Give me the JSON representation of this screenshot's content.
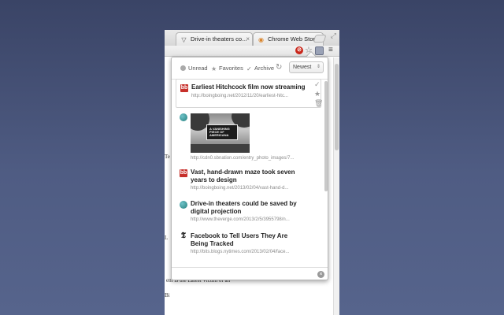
{
  "browser": {
    "tabs": [
      {
        "label": "Drive-in theaters co...",
        "icon": "verge-favicon"
      },
      {
        "label": "Chrome Web Store",
        "icon": "chrome-store-favicon"
      }
    ],
    "page_footer_text": "ent Is the Latest Victim of an",
    "page_sliver_lines": [
      "Te",
      "",
      "L",
      "Bi",
      "L",
      "Ti"
    ]
  },
  "popup": {
    "filters": [
      {
        "label": "Unread",
        "icon": "circle-icon"
      },
      {
        "label": "Favorites",
        "icon": "star-icon"
      },
      {
        "label": "Archive",
        "icon": "check-icon"
      }
    ],
    "sort": {
      "selected": "Newest"
    },
    "items": [
      {
        "title": "Earliest Hitchcock film now streaming",
        "url": "http://boingboing.net/2012/11/20/earliest-hitc...",
        "source_icon": "boingboing-icon"
      },
      {
        "title": "",
        "url": "http://cdn0.sbnation.com/entry_photo_images/7...",
        "source_icon": "verge-icon",
        "thumbnail_text": "A VANISHING PIECE OF AMERICANA"
      },
      {
        "title": "Vast, hand-drawn maze took seven years to design",
        "url": "http://boingboing.net/2013/02/04/vast-hand-d...",
        "source_icon": "boingboing-icon"
      },
      {
        "title": "Drive-in theaters could be saved by digital projection",
        "url": "http://www.theverge.com/2013/2/5/3955798/n...",
        "source_icon": "verge-icon"
      },
      {
        "title": "Facebook to Tell Users They Are Being Tracked",
        "url": "http://bits.blogs.nytimes.com/2013/02/04/face...",
        "source_icon": "nytimes-icon"
      }
    ],
    "search": {
      "value": "",
      "placeholder": ""
    }
  }
}
